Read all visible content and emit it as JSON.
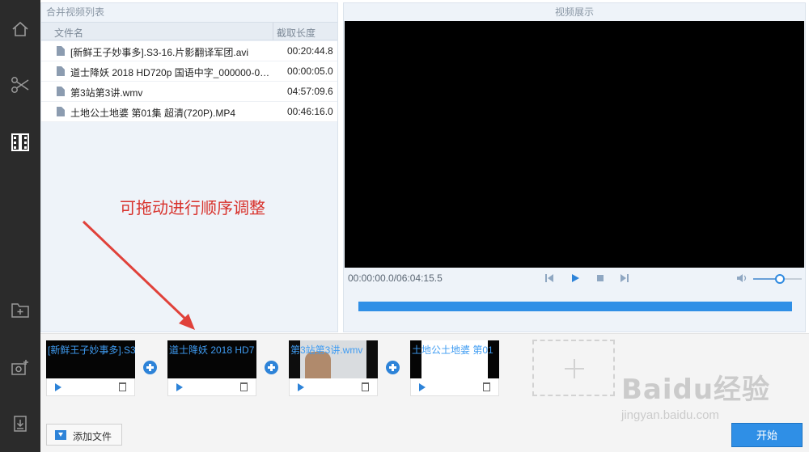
{
  "file_list": {
    "title": "合并视频列表",
    "columns": {
      "name": "文件名",
      "length": "截取长度"
    },
    "rows": [
      {
        "name": "[新鲜王子妙事多].S3-16.片影翻译军团.avi",
        "length": "00:20:44.8"
      },
      {
        "name": "道士降妖 2018 HD720p 国语中字_000000-00...",
        "length": "00:00:05.0"
      },
      {
        "name": "第3站第3讲.wmv",
        "length": "04:57:09.6"
      },
      {
        "name": "土地公土地婆 第01集 超清(720P).MP4",
        "length": "00:46:16.0"
      }
    ]
  },
  "preview": {
    "title": "视频展示",
    "timecode": "00:00:00.0/06:04:15.5",
    "volume_level": 0.55
  },
  "annotation": "可拖动进行顺序调整",
  "timeline": {
    "clips": [
      {
        "label": "[新鲜王子妙事多].S3"
      },
      {
        "label": "道士降妖 2018 HD7"
      },
      {
        "label": "第3站第3讲.wmv"
      },
      {
        "label": "土地公土地婆 第01"
      }
    ],
    "add_file_label": "添加文件",
    "start_label": "开始"
  },
  "watermark": {
    "brand": "Baidu经验",
    "url": "jingyan.baidu.com"
  },
  "colors": {
    "accent": "#2f8fe6",
    "annotation": "#d8322c",
    "sidebar": "#2b2b2b"
  }
}
